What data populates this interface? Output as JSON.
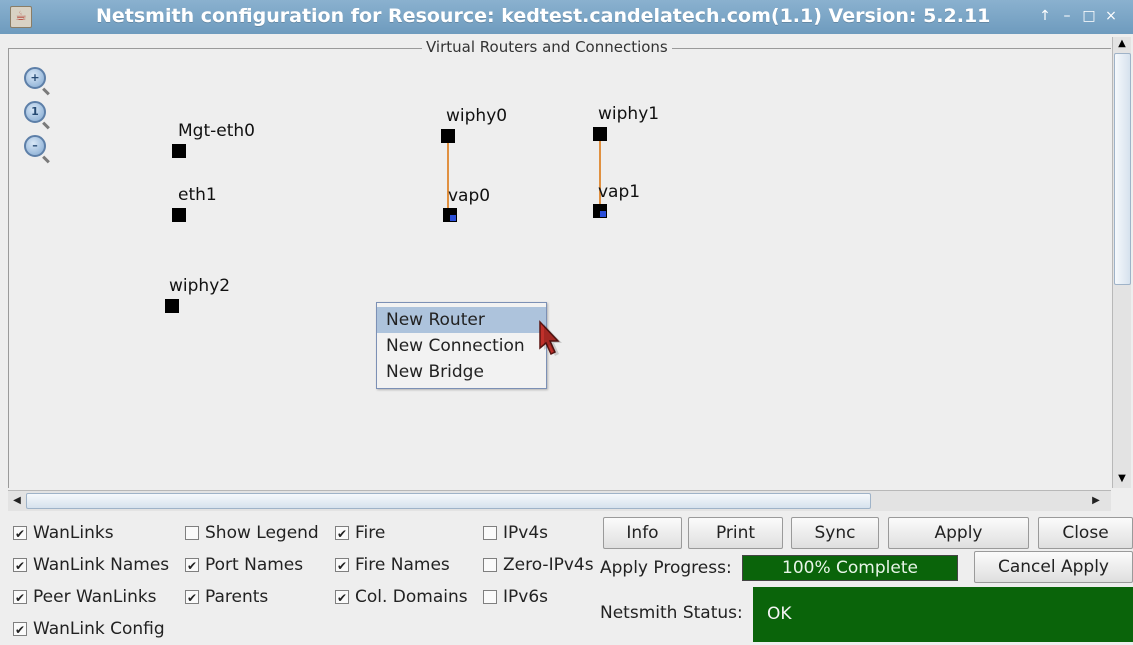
{
  "window": {
    "title": "Netsmith configuration for Resource:  kedtest.candelatech.com(1.1)  Version: 5.2.11",
    "controls": [
      "↑",
      "–",
      "□",
      "×"
    ]
  },
  "canvas": {
    "group_title": "Virtual Routers and Connections",
    "zoom_icons": [
      "zoom-in-icon",
      "zoom-reset-icon",
      "zoom-out-icon"
    ],
    "nodes": [
      {
        "label": "Mgt-eth0"
      },
      {
        "label": "eth1"
      },
      {
        "label": "wiphy2"
      },
      {
        "label": "wiphy0"
      },
      {
        "label": "vap0"
      },
      {
        "label": "wiphy1"
      },
      {
        "label": "vap1"
      }
    ]
  },
  "context_menu": {
    "items": [
      "New Router",
      "New Connection",
      "New Bridge"
    ],
    "highlighted": "New Router"
  },
  "options": {
    "col1": [
      {
        "label": "WanLinks",
        "checked": true
      },
      {
        "label": "WanLink Names",
        "checked": true
      },
      {
        "label": "Peer WanLinks",
        "checked": true
      },
      {
        "label": "WanLink Config",
        "checked": true
      }
    ],
    "col2": [
      {
        "label": "Show Legend",
        "checked": false
      },
      {
        "label": "Port Names",
        "checked": true
      },
      {
        "label": "Parents",
        "checked": true
      }
    ],
    "col3": [
      {
        "label": "Fire",
        "checked": true
      },
      {
        "label": "Fire Names",
        "checked": true
      },
      {
        "label": "Col. Domains",
        "checked": true
      }
    ],
    "col4": [
      {
        "label": "IPv4s",
        "checked": false
      },
      {
        "label": "Zero-IPv4s",
        "checked": false
      },
      {
        "label": "IPv6s",
        "checked": false
      }
    ]
  },
  "buttons": {
    "info": "Info",
    "print": "Print",
    "sync": "Sync",
    "apply": "Apply",
    "close": "Close",
    "cancel_apply": "Cancel Apply"
  },
  "apply_progress": {
    "label": "Apply Progress:",
    "text": "100% Complete",
    "percent": 100,
    "color": "#0a640a"
  },
  "netsmith_status": {
    "label": "Netsmith Status:",
    "text": "OK",
    "color": "#0a640a"
  }
}
